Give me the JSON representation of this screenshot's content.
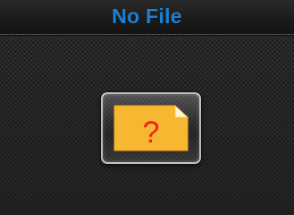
{
  "header": {
    "title": "No File"
  },
  "main": {
    "status_icon": {
      "name": "unknown-file-icon",
      "glyph": "?",
      "colors": {
        "body": "#f7b731",
        "corner_fold": "#fff5d0",
        "glyph": "#e8231e"
      }
    }
  },
  "colors": {
    "title": "#1e7fd0",
    "background": "#2f2f2f",
    "frame_border": "#ebebeb"
  }
}
